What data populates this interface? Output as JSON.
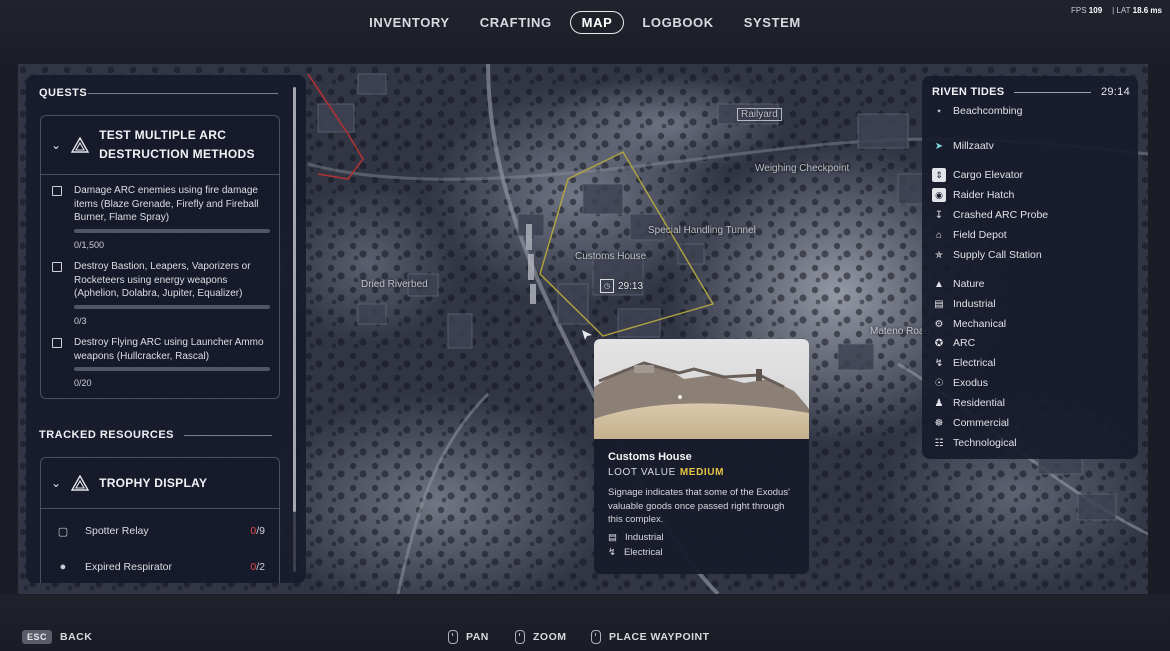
{
  "nav": {
    "tabs": [
      {
        "label": "INVENTORY"
      },
      {
        "label": "CRAFTING"
      },
      {
        "label": "MAP"
      },
      {
        "label": "LOGBOOK"
      },
      {
        "label": "SYSTEM"
      }
    ],
    "active_tab": "MAP"
  },
  "perf": {
    "fps_label": "FPS",
    "fps_value": "109",
    "lat_label": "LAT",
    "lat_value": "18.6 ms"
  },
  "quests": {
    "title": "QUESTS",
    "card_title": "TEST MULTIPLE ARC DESTRUCTION METHODS",
    "items": [
      {
        "text": "Damage ARC enemies using fire damage items (Blaze Grenade, Firefly and Fireball Burner, Flame Spray)",
        "progress": "0/1,500"
      },
      {
        "text": "Destroy Bastion, Leapers, Vaporizers or Rocketeers using energy weapons (Aphelion, Dolabra, Jupiter, Equalizer)",
        "progress": "0/3"
      },
      {
        "text": "Destroy Flying ARC using Launcher Ammo weapons (Hullcracker, Rascal)",
        "progress": "0/20"
      }
    ]
  },
  "tracked": {
    "title": "TRACKED RESOURCES",
    "card_title": "TROPHY DISPLAY",
    "items": [
      {
        "name": "Spotter Relay",
        "have": "0",
        "need": "/9"
      },
      {
        "name": "Expired Respirator",
        "have": "0",
        "need": "/2"
      }
    ]
  },
  "map_labels": {
    "railyard": "Railyard",
    "weighing": "Weighing Checkpoint",
    "special": "Special Handling Tunnel",
    "customs": "Customs House",
    "dried": "Dried Riverbed",
    "mateno": "Mateno Road",
    "marker_time": "29:13"
  },
  "legend": {
    "event_title": "RIVEN TIDES",
    "event_time": "29:14",
    "event_sub": "Beachcombing",
    "player": "Millzaatv",
    "items": [
      {
        "label": "Cargo Elevator",
        "icon": "elevator-icon"
      },
      {
        "label": "Raider Hatch",
        "icon": "hatch-icon"
      },
      {
        "label": "Crashed ARC Probe",
        "icon": "probe-icon"
      },
      {
        "label": "Field Depot",
        "icon": "depot-icon"
      },
      {
        "label": "Supply Call Station",
        "icon": "supply-icon"
      }
    ],
    "categories": [
      {
        "label": "Nature",
        "icon": "nature-icon"
      },
      {
        "label": "Industrial",
        "icon": "industrial-icon"
      },
      {
        "label": "Mechanical",
        "icon": "mechanical-icon"
      },
      {
        "label": "ARC",
        "icon": "arc-icon"
      },
      {
        "label": "Electrical",
        "icon": "electrical-icon"
      },
      {
        "label": "Exodus",
        "icon": "exodus-icon"
      },
      {
        "label": "Residential",
        "icon": "residential-icon"
      },
      {
        "label": "Commercial",
        "icon": "commercial-icon"
      },
      {
        "label": "Technological",
        "icon": "technological-icon"
      }
    ]
  },
  "tooltip": {
    "title": "Customs House",
    "loot_label": "LOOT VALUE",
    "loot_value": "MEDIUM",
    "description": "Signage indicates that some of the Exodus' valuable goods once passed right through this complex.",
    "tags": [
      "Industrial",
      "Electrical"
    ]
  },
  "hints": {
    "esc_key": "ESC",
    "back": "BACK",
    "pan": "PAN",
    "zoom": "ZOOM",
    "waypoint": "PLACE WAYPOINT"
  },
  "colors": {
    "loot_medium": "#e6c545",
    "missing_count": "#e24b4b",
    "zone_outline": "#d6c64a",
    "player_marker": "#7fd3e0"
  }
}
